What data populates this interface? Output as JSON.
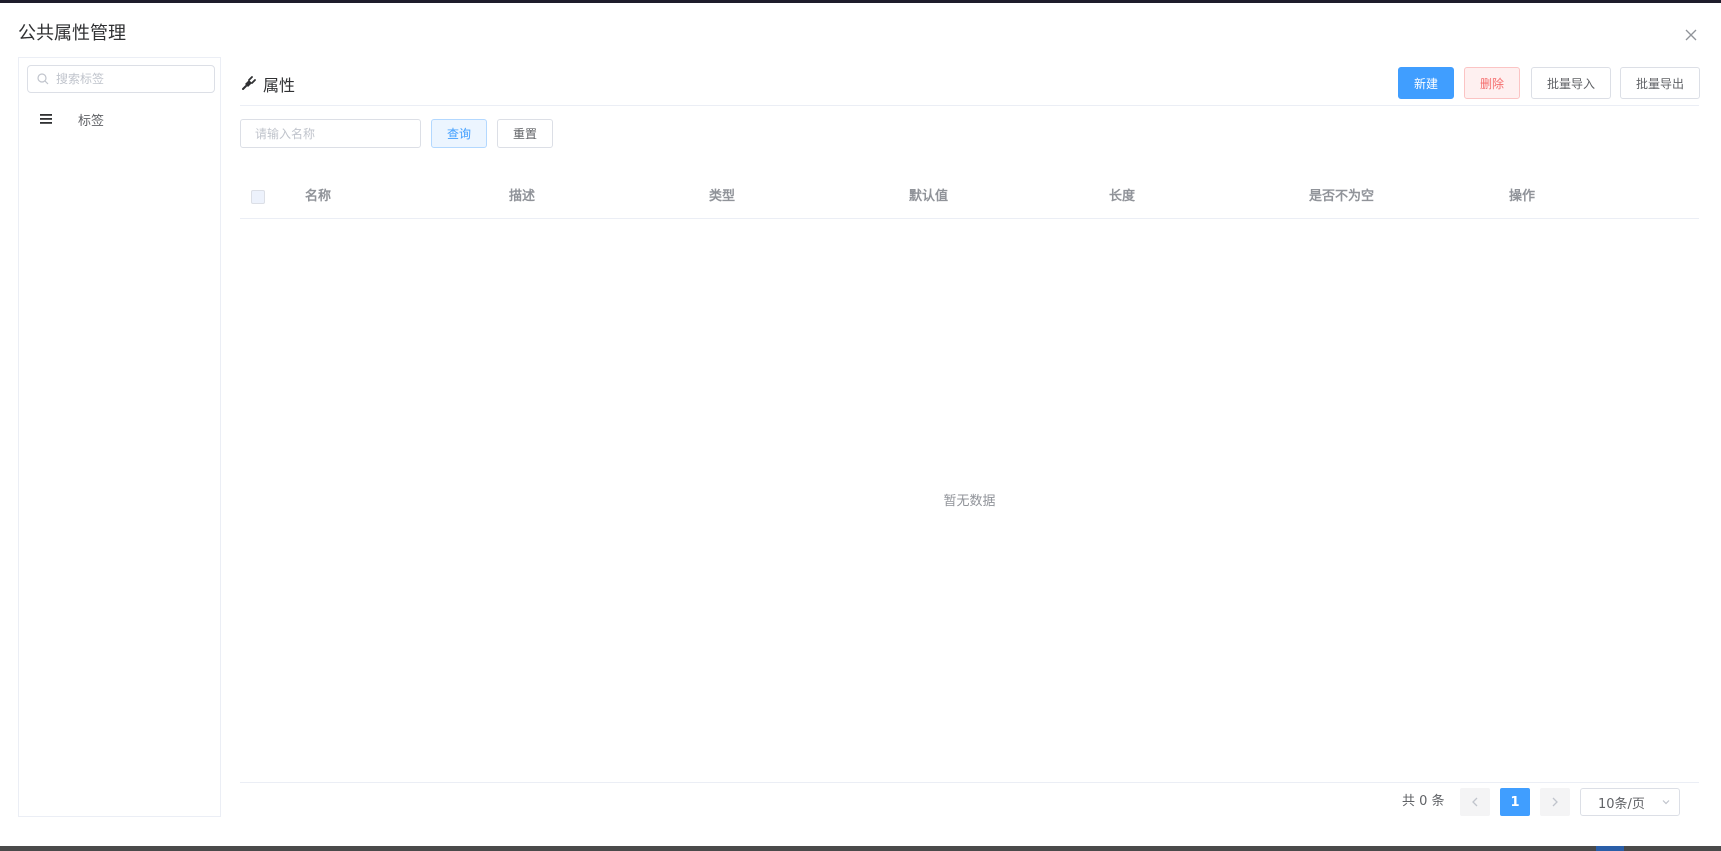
{
  "dialog": {
    "title": "公共属性管理"
  },
  "sidebar": {
    "search_placeholder": "搜索标签",
    "items": [
      {
        "label": "标签"
      }
    ]
  },
  "main": {
    "title": "属性",
    "toolbar": {
      "new_label": "新建",
      "delete_label": "删除",
      "import_label": "批量导入",
      "export_label": "批量导出"
    },
    "filter": {
      "name_placeholder": "请输入名称",
      "query_label": "查询",
      "reset_label": "重置"
    },
    "table": {
      "columns": [
        "名称",
        "描述",
        "类型",
        "默认值",
        "长度",
        "是否不为空",
        "操作"
      ],
      "rows": [],
      "empty_text": "暂无数据"
    },
    "pagination": {
      "total_text": "共 0 条",
      "current_page": "1",
      "page_size": "10条/页"
    }
  },
  "colors": {
    "primary": "#409eff",
    "danger": "#f56c6c",
    "border": "#dcdfe6",
    "text_secondary": "#909399"
  }
}
